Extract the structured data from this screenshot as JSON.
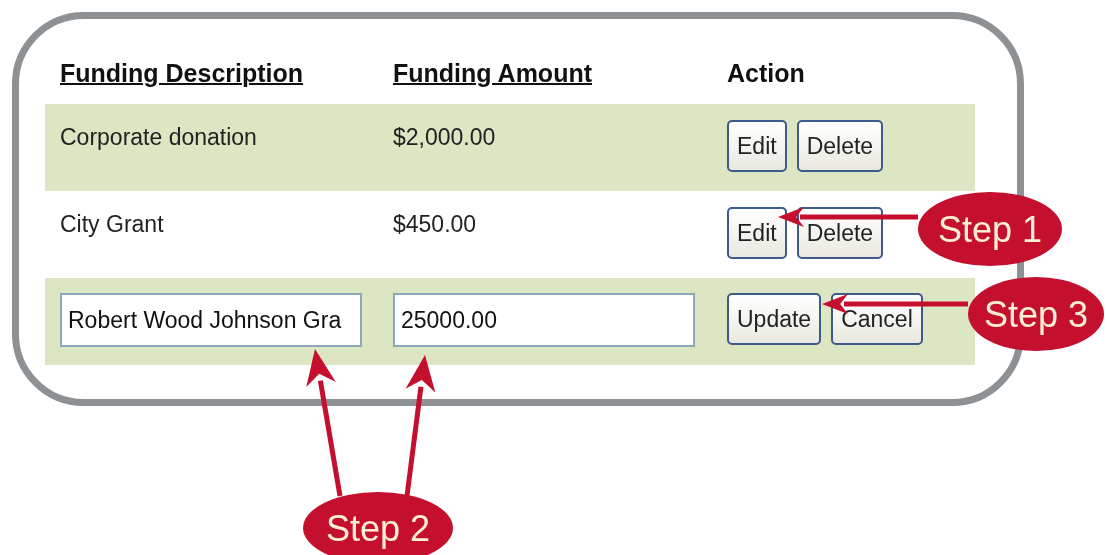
{
  "table": {
    "columns": [
      {
        "label": "Funding Description",
        "sortable": true
      },
      {
        "label": "Funding Amount",
        "sortable": true
      },
      {
        "label": "Action",
        "sortable": false
      }
    ],
    "rows": [
      {
        "description": "Corporate donation",
        "amount": "$2,000.00",
        "editing": false,
        "actions": [
          "Edit",
          "Delete"
        ]
      },
      {
        "description": "City Grant",
        "amount": "$450.00",
        "editing": false,
        "actions": [
          "Edit",
          "Delete"
        ]
      },
      {
        "description": "Robert Wood Johnson Gra",
        "amount": "25000.00",
        "editing": true,
        "actions": [
          "Update",
          "Cancel"
        ]
      }
    ]
  },
  "callouts": [
    {
      "label": "Step 1"
    },
    {
      "label": "Step 2"
    },
    {
      "label": "Step 3"
    }
  ]
}
